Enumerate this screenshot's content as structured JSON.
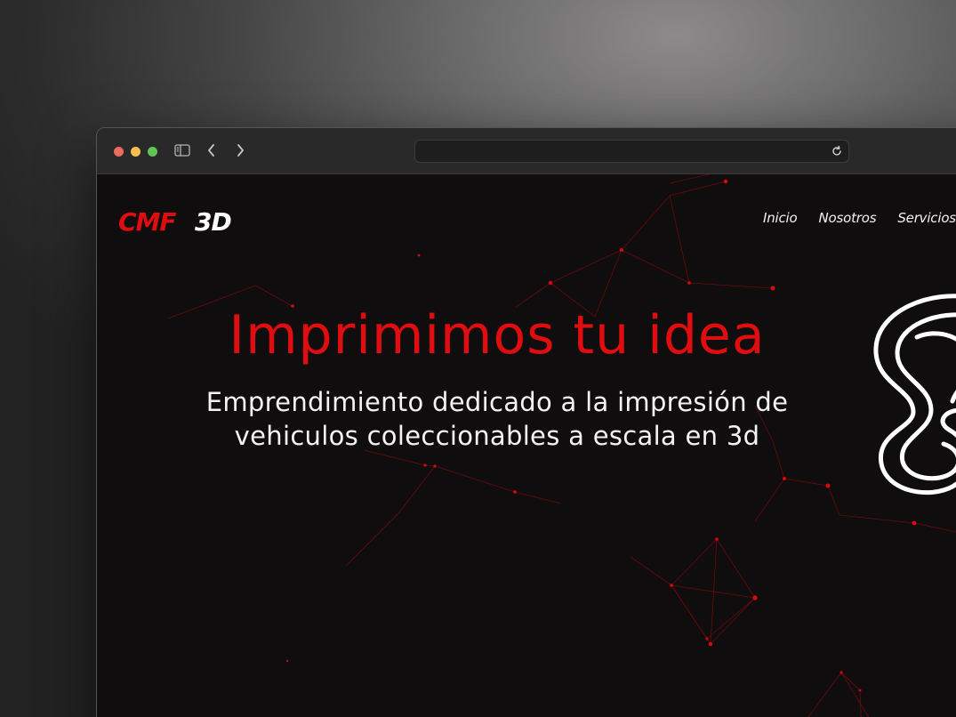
{
  "browser": {
    "address_value": "",
    "traffic_lights": {
      "close": "#ec6a5e",
      "minimize": "#f4bf4f",
      "zoom": "#61c554"
    },
    "icons": [
      "sidebar-icon",
      "back-arrow-icon",
      "forward-arrow-icon",
      "reload-icon"
    ]
  },
  "site": {
    "logo": {
      "part1": "CMF",
      "part2": "3D",
      "color1": "#e00d10",
      "color2": "#ffffff"
    },
    "nav": {
      "items": [
        "Inicio",
        "Nosotros",
        "Servicios"
      ]
    },
    "hero": {
      "title": "Imprimimos tu idea",
      "subtitle_line1": "Emprendimiento dedicado a la impresión de",
      "subtitle_line2": "vehiculos coleccionables a escala en 3d",
      "title_color": "#e00d10"
    },
    "background_color": "#100d0e",
    "accent_color": "#e00d10"
  }
}
